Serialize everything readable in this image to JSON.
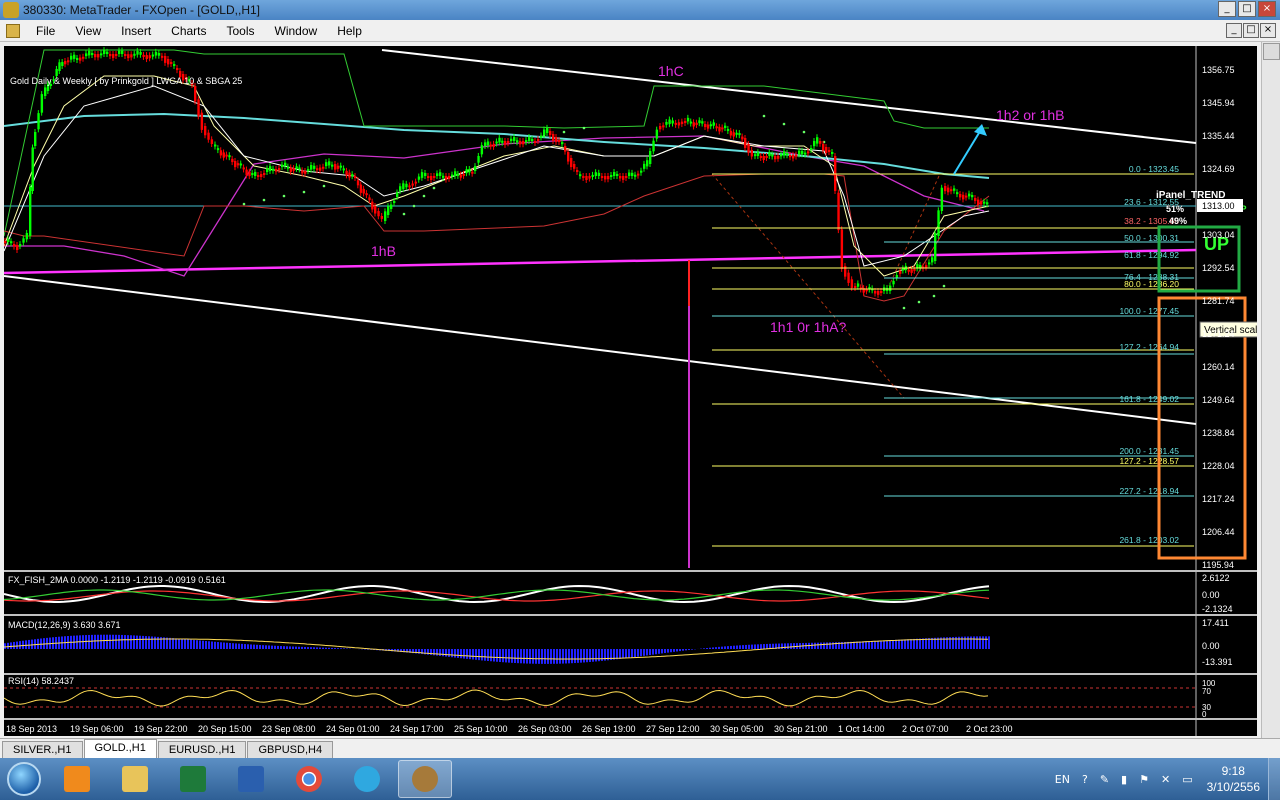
{
  "window": {
    "title": "380330: MetaTrader - FXOpen - [GOLD,,H1]",
    "minimize": "_",
    "maximize": "□",
    "close": "×"
  },
  "menu": [
    "File",
    "View",
    "Insert",
    "Charts",
    "Tools",
    "Window",
    "Help"
  ],
  "chart": {
    "header": "Gold Daily & Weekly [ by Prinkgold ] LWGA 10 & SBGA 25",
    "current_price": "1313.00",
    "price_axis": [
      "1356.75",
      "1345.94",
      "1335.44",
      "1324.69",
      "1313.00",
      "1303.04",
      "1292.54",
      "1281.74",
      "1271.24",
      "1260.14",
      "1249.64",
      "1238.84",
      "1228.04",
      "1217.24",
      "1206.44",
      "1195.94"
    ],
    "time_axis": [
      "18 Sep 2013",
      "19 Sep 06:00",
      "19 Sep 22:00",
      "20 Sep 15:00",
      "23 Sep 08:00",
      "24 Sep 01:00",
      "24 Sep 17:00",
      "25 Sep 10:00",
      "26 Sep 03:00",
      "26 Sep 19:00",
      "27 Sep 12:00",
      "30 Sep 05:00",
      "30 Sep 21:00",
      "1 Oct 14:00",
      "2 Oct 07:00",
      "2 Oct 23:00"
    ],
    "annotations": [
      "1hC",
      "1hB",
      "1h2 or 1hB",
      "1h1 0r 1hA?"
    ],
    "fib_levels": [
      "0.0 - 1323.45",
      "23.6 - 1312.55",
      "38.2 - 1305.68",
      "50.0 - 1300.31",
      "61.8 - 1294.92",
      "76.4 - 1288.31",
      "80.0 - 1286.20",
      "100.0 - 1277.45",
      "127.2 - 1264.94",
      "161.8 - 1249.02",
      "200.0 - 1231.45",
      "127.2 - 1228.57",
      "227.2 - 1218.94",
      "261.8 - 1203.02"
    ],
    "ipanel": {
      "title": "iPanel_TREND",
      "pct_up": "51%",
      "pct_down": "49%",
      "label_up": "UP",
      "label_big": "UP"
    },
    "tooltip": "Vertical scale"
  },
  "indicators": {
    "fish": {
      "label": "FX_FISH_2MA 0.0000 -1.2119 -1.2119 -0.0919 0.5161",
      "axis": [
        "2.6122",
        "0.00",
        "-2.1324"
      ]
    },
    "macd": {
      "label": "MACD(12,26,9) 3.630 3.671",
      "axis": [
        "17.411",
        "0.00",
        "-13.391"
      ]
    },
    "rsi": {
      "label": "RSI(14) 58.2437",
      "axis": [
        "100",
        "70",
        "30",
        "0"
      ]
    }
  },
  "tabs": [
    "SILVER.,H1",
    "GOLD.,H1",
    "EURUSD.,H1",
    "GBPUSD,H4"
  ],
  "active_tab": "GOLD.,H1",
  "taskbar": {
    "apps": [
      "media-player",
      "file-explorer",
      "excel",
      "word",
      "chrome",
      "internet-explorer",
      "metatrader"
    ],
    "language": "EN",
    "time": "9:18",
    "date": "3/10/2556"
  },
  "colors": {
    "bull": "#00ff00",
    "bear": "#ff0000",
    "annotation": "#e030e0",
    "fib": "#ffff66",
    "green_box": "#22aa44",
    "orange_box": "#ff8833"
  }
}
